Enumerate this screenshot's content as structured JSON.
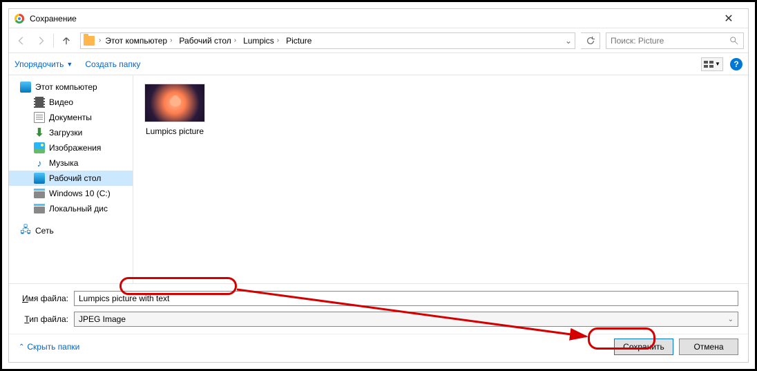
{
  "title": "Сохранение",
  "breadcrumbs": [
    "Этот компьютер",
    "Рабочий стол",
    "Lumpics",
    "Picture"
  ],
  "search_placeholder": "Поиск: Picture",
  "toolbar": {
    "organize": "Упорядочить",
    "newfolder": "Создать папку"
  },
  "tree": {
    "this_pc": "Этот компьютер",
    "videos": "Видео",
    "documents": "Документы",
    "downloads": "Загрузки",
    "pictures": "Изображения",
    "music": "Музыка",
    "desktop": "Рабочий стол",
    "drive_c": "Windows 10 (C:)",
    "local_disk": "Локальный дис",
    "network": "Сеть"
  },
  "files": {
    "item1": "Lumpics picture"
  },
  "labels": {
    "filename": "Имя файла:",
    "filetype": "Тип файла:"
  },
  "filename_value": "Lumpics picture with text",
  "filetype_value": "JPEG Image",
  "hide_folders": "Скрыть папки",
  "buttons": {
    "save": "Сохранить",
    "cancel": "Отмена"
  }
}
